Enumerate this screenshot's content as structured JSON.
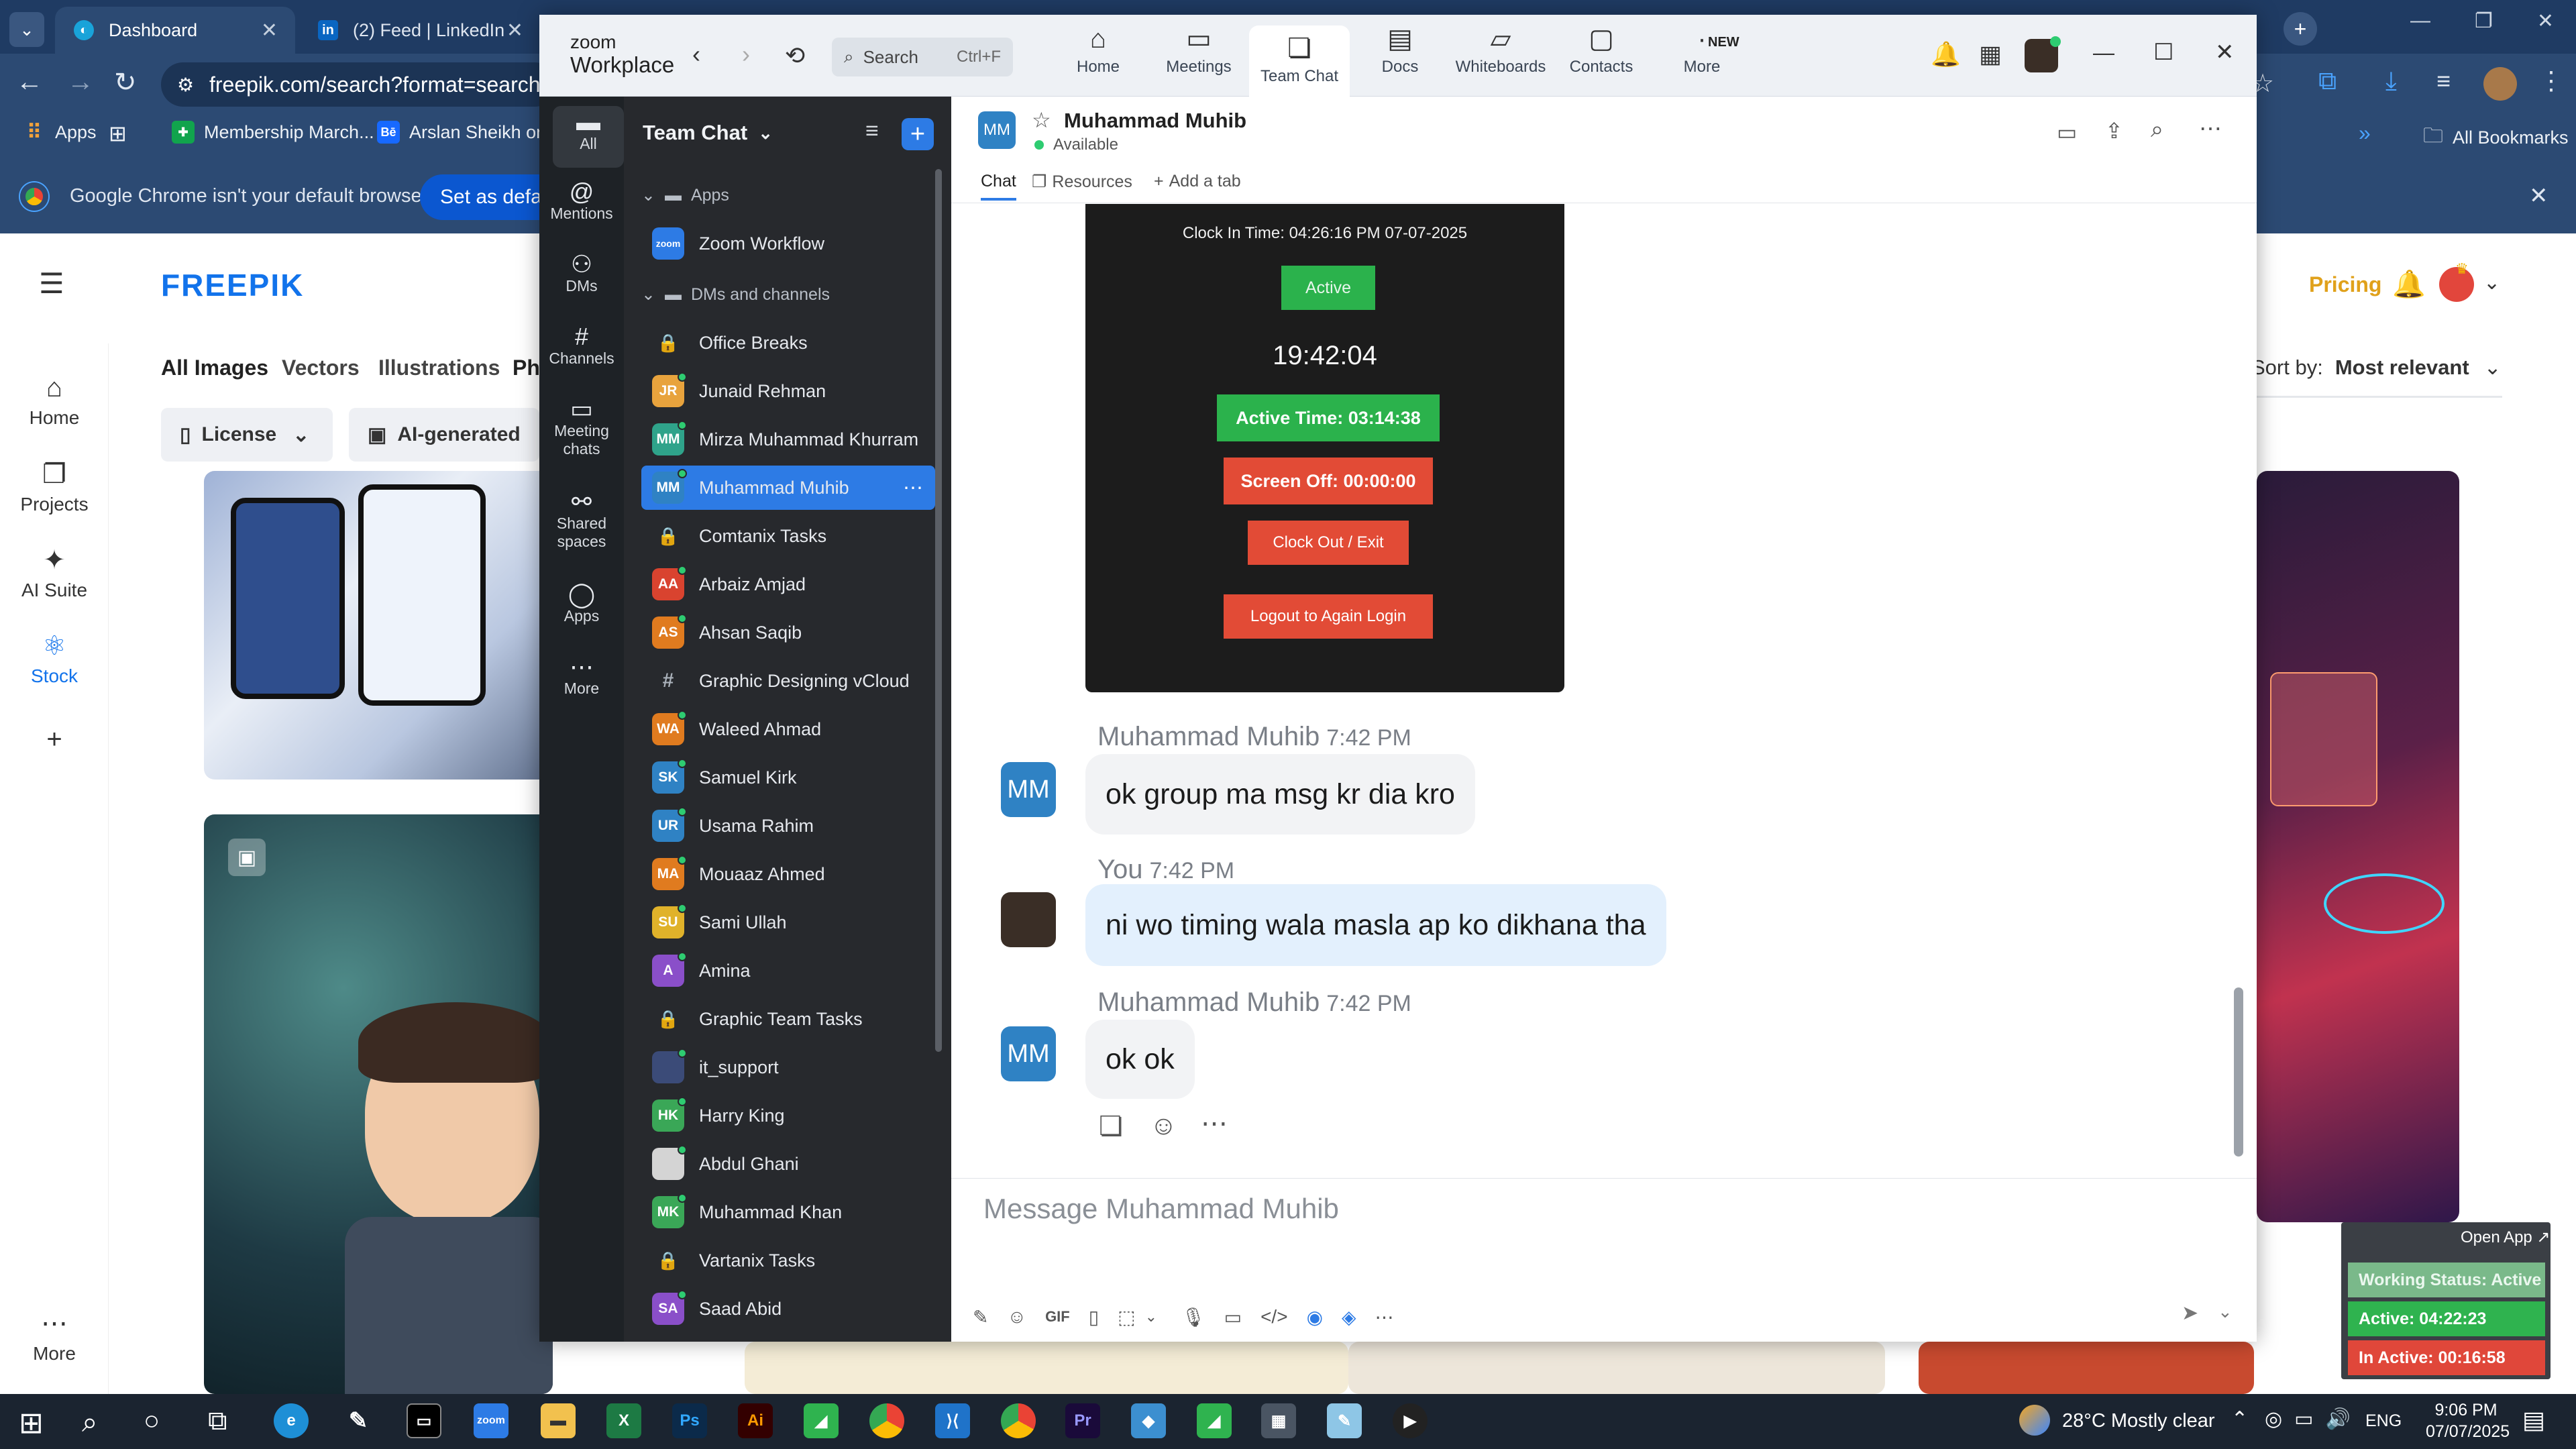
{
  "browser": {
    "tabs": [
      {
        "title": "Dashboard"
      },
      {
        "title": "(2) Feed | LinkedIn"
      }
    ],
    "url": "freepik.com/search?format=search&last",
    "bookmarks": [
      {
        "label": "Apps"
      },
      {
        "label": "Membership March..."
      },
      {
        "label": "Arslan Sheikh on B"
      }
    ],
    "all_bookmarks": "All Bookmarks",
    "infobar": {
      "message": "Google Chrome isn't your default browser",
      "button": "Set as default"
    }
  },
  "freepik": {
    "logo": "FREEPIK",
    "nav": [
      {
        "label": "Home"
      },
      {
        "label": "Projects"
      },
      {
        "label": "AI Suite"
      },
      {
        "label": "Stock"
      },
      {
        "label": "More"
      }
    ],
    "categories": [
      "All Images",
      "Vectors",
      "Illustrations",
      "Ph"
    ],
    "filters": [
      {
        "label": "License"
      },
      {
        "label": "AI-generated"
      }
    ],
    "pricing": "Pricing",
    "sort_label": "Sort by:",
    "sort_value": "Most relevant"
  },
  "zoom": {
    "brand_top": "zoom",
    "brand_bottom": "Workplace",
    "search_placeholder": "Search",
    "search_shortcut": "Ctrl+F",
    "top_nav": [
      {
        "label": "Home"
      },
      {
        "label": "Meetings"
      },
      {
        "label": "Team Chat"
      },
      {
        "label": "Docs"
      },
      {
        "label": "Whiteboards"
      },
      {
        "label": "Contacts"
      },
      {
        "label": "More"
      }
    ],
    "new_badge": "NEW",
    "rail": [
      {
        "label": "All"
      },
      {
        "label": "Mentions"
      },
      {
        "label": "DMs"
      },
      {
        "label": "Channels"
      },
      {
        "label": "Meeting chats"
      },
      {
        "label": "Shared spaces"
      },
      {
        "label": "Apps"
      },
      {
        "label": "More"
      }
    ],
    "list_title": "Team Chat",
    "groups": {
      "apps": "Apps",
      "dms": "DMs and channels"
    },
    "apps": [
      {
        "name": "Zoom Workflow"
      }
    ],
    "contacts": [
      {
        "name": "Office Breaks",
        "avatar": "",
        "type": "lock",
        "color": ""
      },
      {
        "name": "Junaid Rehman",
        "avatar": "JR",
        "type": "person",
        "color": "#e8a33d"
      },
      {
        "name": "Mirza Muhammad Khurram",
        "avatar": "MM",
        "type": "person",
        "color": "#2fa38a"
      },
      {
        "name": "Muhammad Muhib",
        "avatar": "MM",
        "type": "person",
        "color": "#2f82c4"
      },
      {
        "name": "Comtanix Tasks",
        "avatar": "",
        "type": "lock",
        "color": ""
      },
      {
        "name": "Arbaiz Amjad",
        "avatar": "AA",
        "type": "person",
        "color": "#d9432f"
      },
      {
        "name": "Ahsan Saqib",
        "avatar": "AS",
        "type": "person",
        "color": "#e07b1f"
      },
      {
        "name": "Graphic Designing vCloud",
        "avatar": "#",
        "type": "hash",
        "color": ""
      },
      {
        "name": "Waleed Ahmad",
        "avatar": "WA",
        "type": "person",
        "color": "#e07b1f"
      },
      {
        "name": "Samuel Kirk",
        "avatar": "SK",
        "type": "person",
        "color": "#2f82c4"
      },
      {
        "name": "Usama Rahim",
        "avatar": "UR",
        "type": "person",
        "color": "#2f82c4"
      },
      {
        "name": "Mouaaz Ahmed",
        "avatar": "MA",
        "type": "person",
        "color": "#e07b1f"
      },
      {
        "name": "Sami Ullah",
        "avatar": "SU",
        "type": "person",
        "color": "#e0b22a"
      },
      {
        "name": "Amina",
        "avatar": "A",
        "type": "person",
        "color": "#8a4fc9"
      },
      {
        "name": "Graphic Team Tasks",
        "avatar": "",
        "type": "lock",
        "color": ""
      },
      {
        "name": "it_support",
        "avatar": "",
        "type": "person",
        "color": "#3b4b78"
      },
      {
        "name": "Harry King",
        "avatar": "HK",
        "type": "person",
        "color": "#3aa757"
      },
      {
        "name": "Abdul Ghani",
        "avatar": "",
        "type": "person",
        "color": "#d4d4d4"
      },
      {
        "name": "Muhammad Khan",
        "avatar": "MK",
        "type": "person",
        "color": "#3aa757"
      },
      {
        "name": "Vartanix Tasks",
        "avatar": "",
        "type": "lock",
        "color": ""
      },
      {
        "name": "Saad Abid",
        "avatar": "SA",
        "type": "person",
        "color": "#8a4fc9"
      }
    ],
    "chat": {
      "header_avatar": "MM",
      "header_name": "Muhammad Muhib",
      "status": "Available",
      "tabs": [
        {
          "label": "Chat"
        },
        {
          "label": "Resources"
        },
        {
          "label": "Add a tab"
        }
      ],
      "screenshot": {
        "clock_in": "Clock In Time: 04:26:16 PM 07-07-2025",
        "status": "Active",
        "time": "19:42:04",
        "active_time": "Active Time: 03:14:38",
        "screen_off": "Screen Off: 00:00:00",
        "clock_out": "Clock Out / Exit",
        "logout": "Logout to Again Login"
      },
      "messages": [
        {
          "sender": "Muhammad Muhib",
          "time": "7:42 PM",
          "text": "ok group ma msg kr dia kro",
          "avatar": "MM"
        },
        {
          "sender": "You",
          "time": "7:42 PM",
          "text": "ni wo timing wala masla ap ko dikhana tha",
          "avatar": ""
        },
        {
          "sender": "Muhammad Muhib",
          "time": "7:42 PM",
          "text": "ok ok",
          "avatar": "MM"
        }
      ],
      "composer_placeholder": "Message Muhammad Muhib",
      "composer_gif": "GIF"
    }
  },
  "widget": {
    "open_app": "Open App ↗",
    "working_status": "Working Status: Active",
    "active": "Active: 04:22:23",
    "inactive": "In Active: 00:16:58"
  },
  "taskbar": {
    "weather": "28°C Mostly clear",
    "lang": "ENG",
    "time": "9:06 PM",
    "date": "07/07/2025"
  }
}
